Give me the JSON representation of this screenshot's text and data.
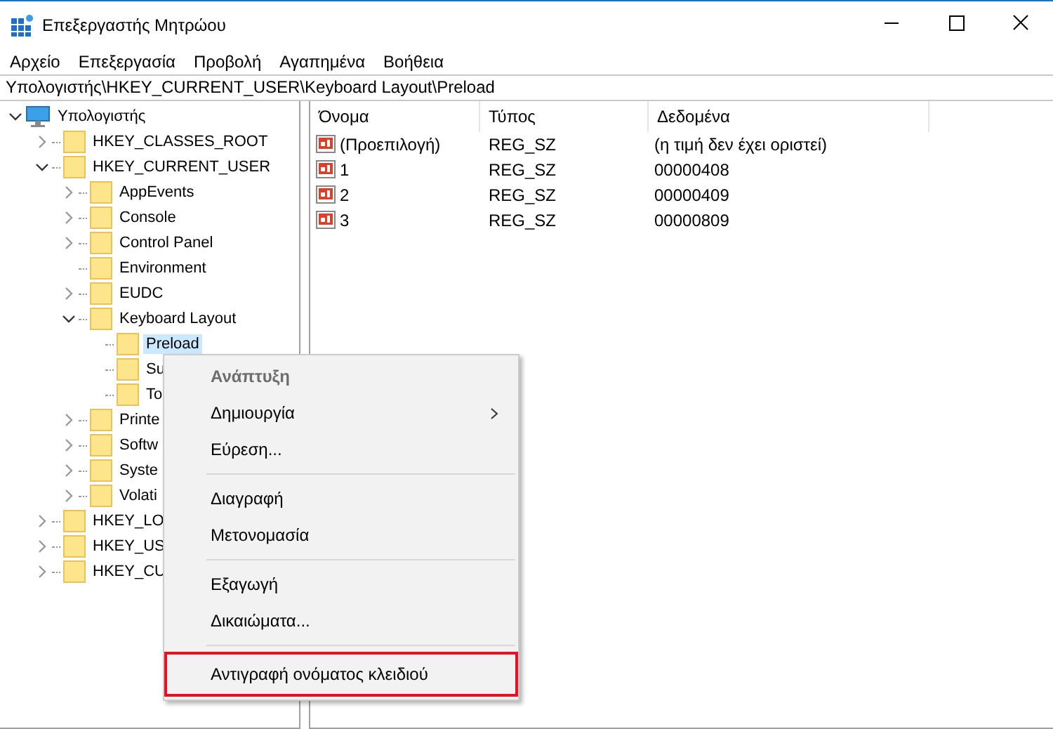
{
  "window": {
    "title": "Επεξεργαστής Μητρώου"
  },
  "menu_bar": [
    "Αρχείο",
    "Επεξεργασία",
    "Προβολή",
    "Αγαπημένα",
    "Βοήθεια"
  ],
  "address": "Υπολογιστής\\HKEY_CURRENT_USER\\Keyboard Layout\\Preload",
  "tree": [
    {
      "label": "Υπολογιστής",
      "kind": "computer",
      "expanded": true,
      "selected": false,
      "children": [
        {
          "label": "HKEY_CLASSES_ROOT",
          "kind": "folder",
          "expanded": false,
          "selected": false
        },
        {
          "label": "HKEY_CURRENT_USER",
          "kind": "folder",
          "expanded": true,
          "selected": false,
          "children": [
            {
              "label": "AppEvents",
              "kind": "folder",
              "expanded": false,
              "selected": false
            },
            {
              "label": "Console",
              "kind": "folder",
              "expanded": false,
              "selected": false
            },
            {
              "label": "Control Panel",
              "kind": "folder",
              "expanded": false,
              "selected": false
            },
            {
              "label": "Environment",
              "kind": "folder",
              "selected": false
            },
            {
              "label": "EUDC",
              "kind": "folder",
              "expanded": false,
              "selected": false
            },
            {
              "label": "Keyboard Layout",
              "kind": "folder",
              "expanded": true,
              "selected": false,
              "children": [
                {
                  "label": "Preload",
                  "kind": "folder",
                  "selected": true
                },
                {
                  "label": "Su",
                  "kind": "folder",
                  "selected": false
                },
                {
                  "label": "To",
                  "kind": "folder",
                  "selected": false
                }
              ]
            },
            {
              "label": "Printe",
              "kind": "folder",
              "expanded": false,
              "selected": false
            },
            {
              "label": "Softw",
              "kind": "folder",
              "expanded": false,
              "selected": false
            },
            {
              "label": "Syste",
              "kind": "folder",
              "expanded": false,
              "selected": false
            },
            {
              "label": "Volati",
              "kind": "folder",
              "expanded": false,
              "selected": false
            }
          ]
        },
        {
          "label": "HKEY_LO",
          "kind": "folder",
          "expanded": false,
          "selected": false
        },
        {
          "label": "HKEY_US",
          "kind": "folder",
          "expanded": false,
          "selected": false
        },
        {
          "label": "HKEY_CU",
          "kind": "folder",
          "expanded": false,
          "selected": false
        }
      ]
    }
  ],
  "table": {
    "columns": [
      "Όνομα",
      "Τύπος",
      "Δεδομένα"
    ],
    "rows": [
      [
        "(Προεπιλογή)",
        "REG_SZ",
        "(η τιμή δεν έχει οριστεί)"
      ],
      [
        "1",
        "REG_SZ",
        "00000408"
      ],
      [
        "2",
        "REG_SZ",
        "00000409"
      ],
      [
        "3",
        "REG_SZ",
        "00000809"
      ]
    ]
  },
  "context_menu": [
    {
      "kind": "default",
      "label": "Ανάπτυξη",
      "highlighted": false
    },
    {
      "kind": "submenu",
      "label": "Δημιουργία",
      "highlighted": false
    },
    {
      "kind": "item",
      "label": "Εύρεση...",
      "highlighted": false
    },
    {
      "kind": "separator"
    },
    {
      "kind": "item",
      "label": "Διαγραφή",
      "highlighted": false
    },
    {
      "kind": "item",
      "label": "Μετονομασία",
      "highlighted": false
    },
    {
      "kind": "separator"
    },
    {
      "kind": "item",
      "label": "Εξαγωγή",
      "highlighted": false
    },
    {
      "kind": "item",
      "label": "Δικαιώματα...",
      "highlighted": false
    },
    {
      "kind": "separator"
    },
    {
      "kind": "item",
      "label": "Αντιγραφή ονόματος κλειδιού",
      "highlighted": true
    }
  ]
}
